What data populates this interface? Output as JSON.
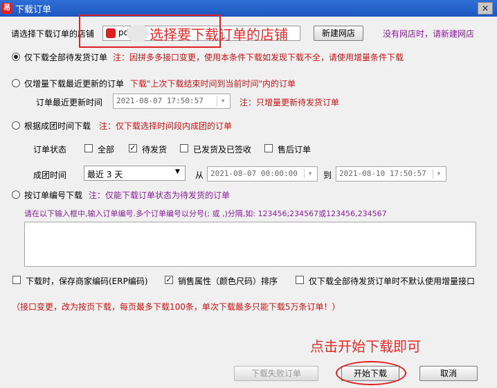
{
  "window": {
    "title": "下载订单",
    "app_icon_glyph": "易",
    "close_glyph": "×"
  },
  "store": {
    "label": "请选择下载订单的店铺",
    "value": "pdd",
    "new_store_button": "新建网店",
    "no_store_hint": "没有网店时，请新建网店"
  },
  "opt1": {
    "label": "仅下载全部待发货订单",
    "note": "注：因拼多多接口变更，使用本条件下载如发现下载不全，请使用增量条件下载",
    "selected": true
  },
  "opt2": {
    "label": "仅增量下载最近更新的订单",
    "note": "下载\"上次下载结束时间到当前时间\"内的订单",
    "update_time_label": "订单最近更新时间",
    "update_time_value": "2021-08-07 17:50:57",
    "update_time_note": "注：只增量更新待发货订单"
  },
  "opt3": {
    "label": "根据成团时间下载",
    "note": "注：仅下载选择时间段内成团的订单"
  },
  "status": {
    "label": "订单状态",
    "options": [
      {
        "label": "全部",
        "checked": false
      },
      {
        "label": "待发货",
        "checked": true
      },
      {
        "label": "已发货及已签收",
        "checked": false
      },
      {
        "label": "售后订单",
        "checked": false
      }
    ]
  },
  "group_time": {
    "label": "成团时间",
    "preset": "最近 3 天",
    "from_label": "从",
    "from_value": "2021-08-07 00:00:00",
    "to_label": "到",
    "to_value": "2021-08-10 17:50:57"
  },
  "opt4": {
    "label": "按订单编号下载",
    "note": "注：仅能下载订单状态为待发货的订单",
    "instruction": "请在以下输入框中,输入订单编号.多个订单编号以分号(; 或 ,)分隔,如: 123456;234567或123456,234567",
    "input_value": ""
  },
  "bottom_checks": [
    {
      "label": "下载时，保存商家编码(ERP编码)",
      "checked": false
    },
    {
      "label": "销售属性（颜色尺码）排序",
      "checked": true
    },
    {
      "label": "仅下载全部待发货订单时不默认使用增量接口",
      "checked": false
    }
  ],
  "notice": "（接口变更，改为按页下载，每页最多下载100条，单次下载最多只能下载5万条订单！）",
  "buttons": {
    "failed_orders": "下载失败订单",
    "start": "开始下载",
    "cancel": "取消"
  },
  "annotations": {
    "select_store": "选择要下载订单的店铺",
    "click_start": "点击开始下载即可",
    "color": "#e02020"
  }
}
